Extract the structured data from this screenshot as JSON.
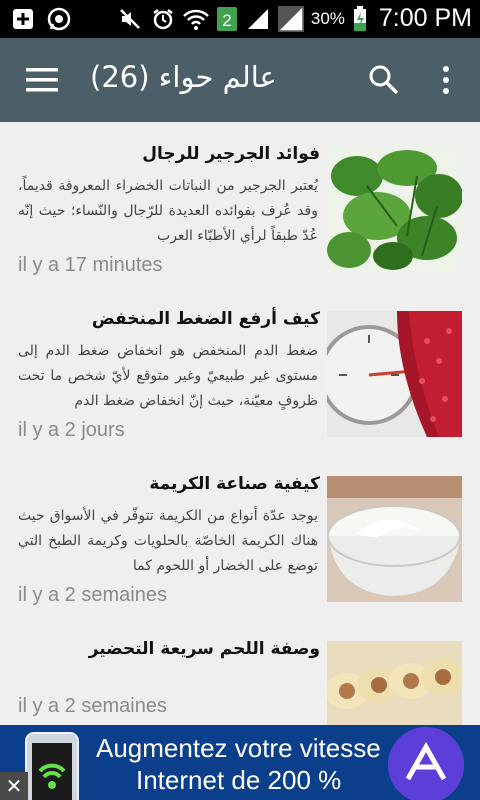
{
  "status_bar": {
    "time": "7:00 PM",
    "battery": "30%",
    "sim_badge": "2",
    "icons": [
      "add-notification-icon",
      "whatsapp-icon",
      "mute-icon",
      "alarm-icon",
      "wifi-icon",
      "sim-2-icon",
      "signal-icon",
      "signal-2-icon",
      "battery-charging-icon"
    ]
  },
  "app_bar": {
    "title": "عالم حواء (26)",
    "icons": [
      "menu-icon",
      "search-icon",
      "more-vert-icon"
    ]
  },
  "articles": [
    {
      "title": "فوائد الجرجير للرجال",
      "excerpt": "يُعتبر الجرجير من النباتات الخضراء المعروفة قديماً، وقد عُرف بفوائده العديدة للرّجال والنّساء؛ حيث إنّه عُدّ طبقاً لرأي الأطبّاء العرب",
      "time": "il y a 17 minutes",
      "image": "arugula-leaves"
    },
    {
      "title": "كيف أرفع الضغط المنخفض",
      "excerpt": "ضغط الدم المنخفض هو انخفاض ضغط الدم إلى مستوى غير طبيعيّ وغير متوقع لأيّ شخص ما تحت ظروفٍ معيّنة، حيث إنّ انخفاض ضغط الدم",
      "time": "il y a 2 jours",
      "image": "blood-pressure-gauge"
    },
    {
      "title": "كيفية صناعة الكريمة",
      "excerpt": "يوجد عدّة أنواع من الكريمة تتوفّر في الأسواق حيث هناك الكريمة الخاصّة بالحلويات وكريمة الطبخ التي توضع على الخضار أو اللحوم كما",
      "time": "il y a 2 semaines",
      "image": "cream-bowl"
    },
    {
      "title": "وصفة اللحم سريعة التحضير",
      "excerpt": "",
      "time": "il y a 2 semaines",
      "image": "meat-rolls"
    }
  ],
  "ad": {
    "line1": "Augmentez votre vitesse",
    "line2": "Internet de 200 %",
    "close": "✕"
  },
  "colors": {
    "app_bar": "#4c5f69",
    "background": "#efefef",
    "ad_background": "#0b3f8c",
    "time_text": "#8a8a8a"
  }
}
